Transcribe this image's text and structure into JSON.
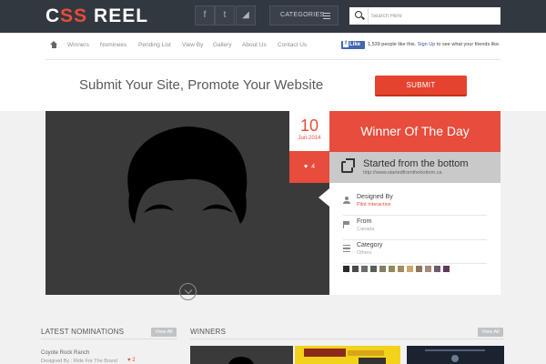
{
  "logo": {
    "part1": "C",
    "part2": "SS",
    "part3": " REEL"
  },
  "social": [
    {
      "icon": "facebook-icon",
      "glyph": "f"
    },
    {
      "icon": "twitter-icon",
      "glyph": "t"
    },
    {
      "icon": "rss-icon",
      "glyph": "◢"
    }
  ],
  "categories_label": "CATEGORIES",
  "search": {
    "placeholder": "Search Here"
  },
  "nav": [
    "Winners",
    "Nominees",
    "Pending List",
    "View By",
    "Gallery",
    "About Us",
    "Contact Us"
  ],
  "facebook": {
    "like_label": "Like",
    "text_before": "1,539 people like this. ",
    "signup": "Sign Up",
    "text_after": " to see what your friends like."
  },
  "promo": {
    "headline": "Submit Your Site, Promote Your Website",
    "submit_label": "SUBMIT"
  },
  "winner": {
    "date_day": "10",
    "date_month": "Jun-2014",
    "likes": "4",
    "heading": "Winner Of The Day",
    "site_title": "Started from the bottom",
    "site_url": "http://www.startedfromthebottom.ca",
    "details": [
      {
        "label": "Designed By",
        "value": "Pilot Interactive",
        "icon": "user-icon",
        "highlight": true
      },
      {
        "label": "From",
        "value": "Canada",
        "icon": "flag-icon",
        "highlight": false
      },
      {
        "label": "Category",
        "value": "Others",
        "icon": "list-icon",
        "highlight": false
      }
    ],
    "palette": [
      "#2b2b2b",
      "#4a4a4a",
      "#6b6b6b",
      "#555f55",
      "#7f7f62",
      "#8e8a5c",
      "#a08a5e",
      "#c9a86a",
      "#8a7560",
      "#a48a78",
      "#6e5a6a",
      "#5c3b5a"
    ]
  },
  "latest": {
    "title": "LATEST NOMINATIONS",
    "view_all": "View All",
    "item_title": "Coyote Rock Ranch",
    "item_by": "Designed By : Ride For The Brand",
    "item_likes": "2"
  },
  "winners": {
    "title": "WINNERS",
    "view_all": "View All"
  },
  "colors": {
    "accent": "#e74c3c",
    "topbar": "#323840",
    "hero_bg": "#3b3a3b"
  }
}
